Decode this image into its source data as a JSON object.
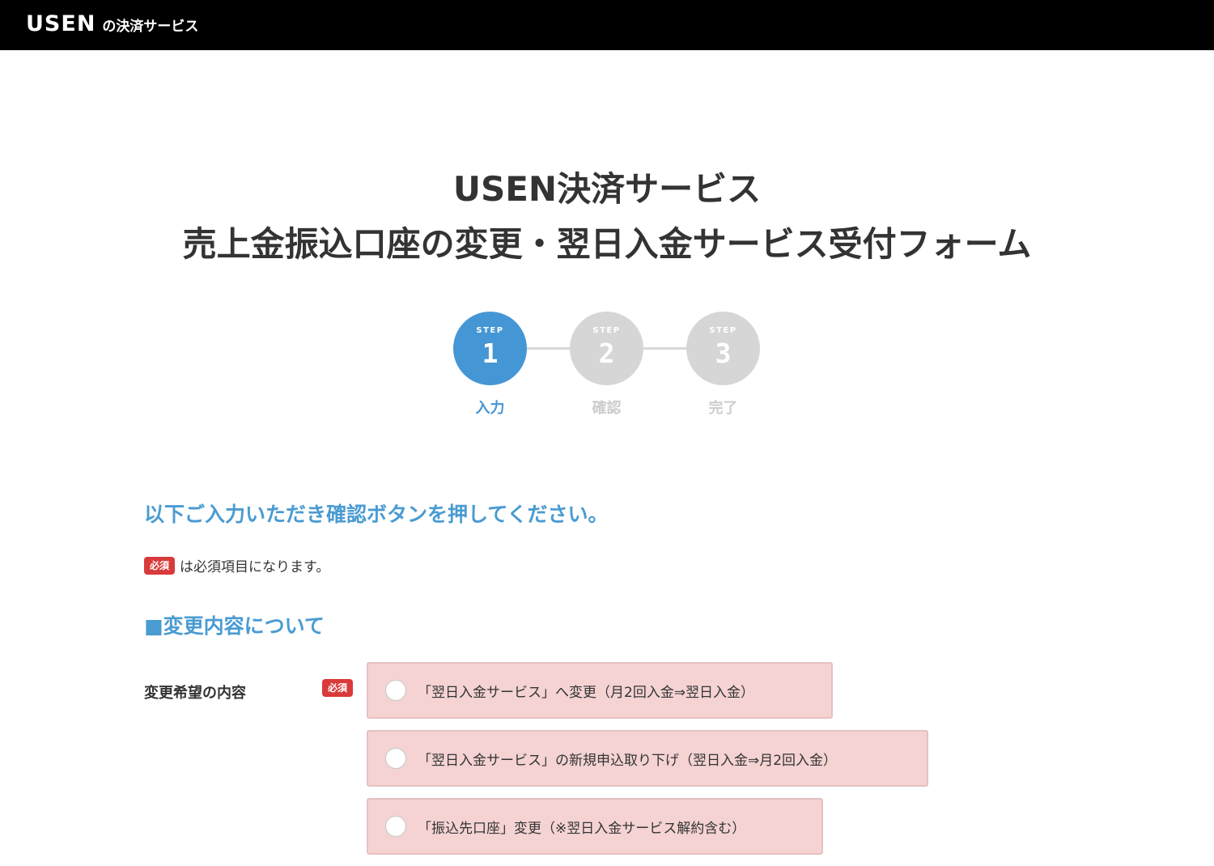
{
  "header": {
    "logo_text": "USEN",
    "logo_sub": "の決済サービス",
    "background": "#000000"
  },
  "title": {
    "line1": "USEN決済サービス",
    "line2": "売上金振込口座の変更・翌日入金サービス受付フォーム"
  },
  "steps": [
    {
      "tag": "STEP",
      "number": "1",
      "label": "入力",
      "state": "active"
    },
    {
      "tag": "STEP",
      "number": "2",
      "label": "確認",
      "state": "inactive"
    },
    {
      "tag": "STEP",
      "number": "3",
      "label": "完了",
      "state": "inactive"
    }
  ],
  "instruction": "以下ご入力いただき確認ボタンを押してください。",
  "required_note": {
    "badge": "必須",
    "text": "は必須項目になります。"
  },
  "section": {
    "heading": "■変更内容について"
  },
  "field": {
    "label": "変更希望の内容",
    "badge": "必須",
    "options": [
      {
        "label": "「翌日入金サービス」へ変更（月2回入金⇒翌日入金）",
        "selected": false
      },
      {
        "label": "「翌日入金サービス」の新規申込取り下げ（翌日入金⇒月2回入金）",
        "selected": false
      },
      {
        "label": "「振込先口座」変更（※翌日入金サービス解約含む）",
        "selected": false
      }
    ]
  },
  "colors": {
    "accent": "#4596d4",
    "heading_blue": "#4a9bd2",
    "required_red": "#d93a3a",
    "option_bg": "#f5d3d3",
    "step_inactive": "#d6d6d6"
  }
}
